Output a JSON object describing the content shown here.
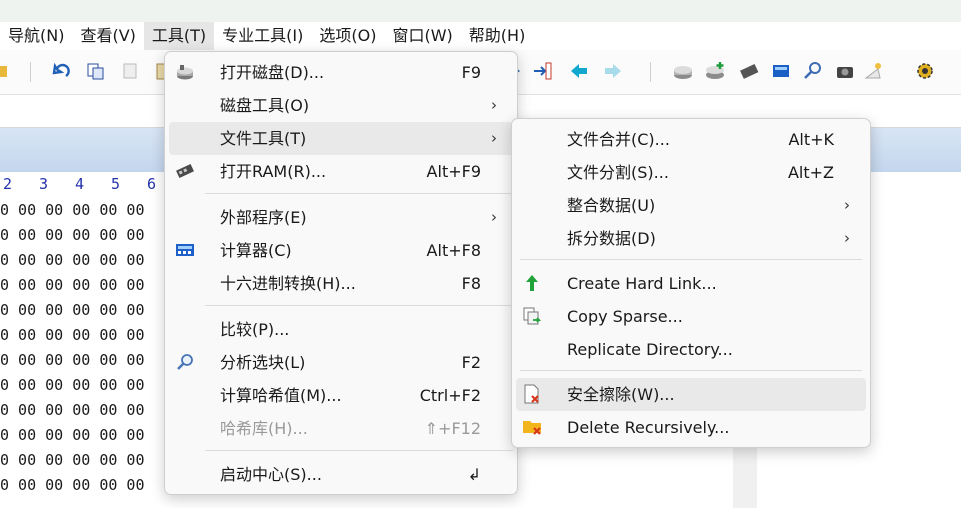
{
  "menubar": {
    "items": [
      "导航(N)",
      "查看(V)",
      "工具(T)",
      "专业工具(I)",
      "选项(O)",
      "窗口(W)",
      "帮助(H)"
    ]
  },
  "hex": {
    "header": [
      "2",
      "3",
      "4",
      "5",
      "6"
    ],
    "rows": [
      "0 00 00 00 00 00",
      "0 00 00 00 00 00",
      "0 00 00 00 00 00",
      "0 00 00 00 00 00",
      "0 00 00 00 00 00",
      "0 00 00 00 00 00",
      "0 00 00 00 00 00",
      "0 00 00 00 00 00",
      "0 00 00 00 00 00",
      "0 00 00 00 00 00",
      "0 00 00 00 00 00",
      "0 00 00 00 00 00"
    ]
  },
  "tools_menu": {
    "items": [
      {
        "label": "打开磁盘(D)...",
        "shortcut": "F9",
        "icon": "disk-icon"
      },
      {
        "label": "磁盘工具(O)",
        "shortcut": "",
        "icon": ""
      },
      {
        "label": "文件工具(T)",
        "shortcut": "",
        "icon": ""
      },
      {
        "label": "打开RAM(R)...",
        "shortcut": "Alt+F9",
        "icon": "ram-chip-icon"
      },
      {
        "label": "外部程序(E)",
        "shortcut": "",
        "icon": ""
      },
      {
        "label": "计算器(C)",
        "shortcut": "Alt+F8",
        "icon": "calculator-icon"
      },
      {
        "label": "十六进制转换(H)...",
        "shortcut": "F8",
        "icon": ""
      },
      {
        "label": "比较(P)...",
        "shortcut": "",
        "icon": ""
      },
      {
        "label": "分析选块(L)",
        "shortcut": "F2",
        "icon": "magnifier-icon"
      },
      {
        "label": "计算哈希值(M)...",
        "shortcut": "Ctrl+F2",
        "icon": ""
      },
      {
        "label": "哈希库(H)...",
        "shortcut": "⇑+F12",
        "icon": ""
      },
      {
        "label": "启动中心(S)...",
        "shortcut": "↲",
        "icon": ""
      }
    ]
  },
  "file_tools_menu": {
    "items": [
      {
        "label": "文件合并(C)...",
        "shortcut": "Alt+K",
        "icon": ""
      },
      {
        "label": "文件分割(S)...",
        "shortcut": "Alt+Z",
        "icon": ""
      },
      {
        "label": "整合数据(U)",
        "shortcut": "",
        "icon": ""
      },
      {
        "label": "拆分数据(D)",
        "shortcut": "",
        "icon": ""
      },
      {
        "label": "Create Hard Link...",
        "shortcut": "",
        "icon": "hard-link-icon"
      },
      {
        "label": "Copy Sparse...",
        "shortcut": "",
        "icon": "copy-sparse-icon"
      },
      {
        "label": "Replicate Directory...",
        "shortcut": "",
        "icon": ""
      },
      {
        "label": "安全擦除(W)...",
        "shortcut": "",
        "icon": "secure-wipe-icon"
      },
      {
        "label": "Delete Recursively...",
        "shortcut": "",
        "icon": "delete-folder-icon"
      }
    ]
  },
  "colors": {
    "menu_bg": "#f9f9f9",
    "highlight": "#e9e9e9",
    "hex_header": "#2233aa",
    "blue_strip": "#c4d6ee",
    "disabled_text": "#9a9a9a"
  }
}
